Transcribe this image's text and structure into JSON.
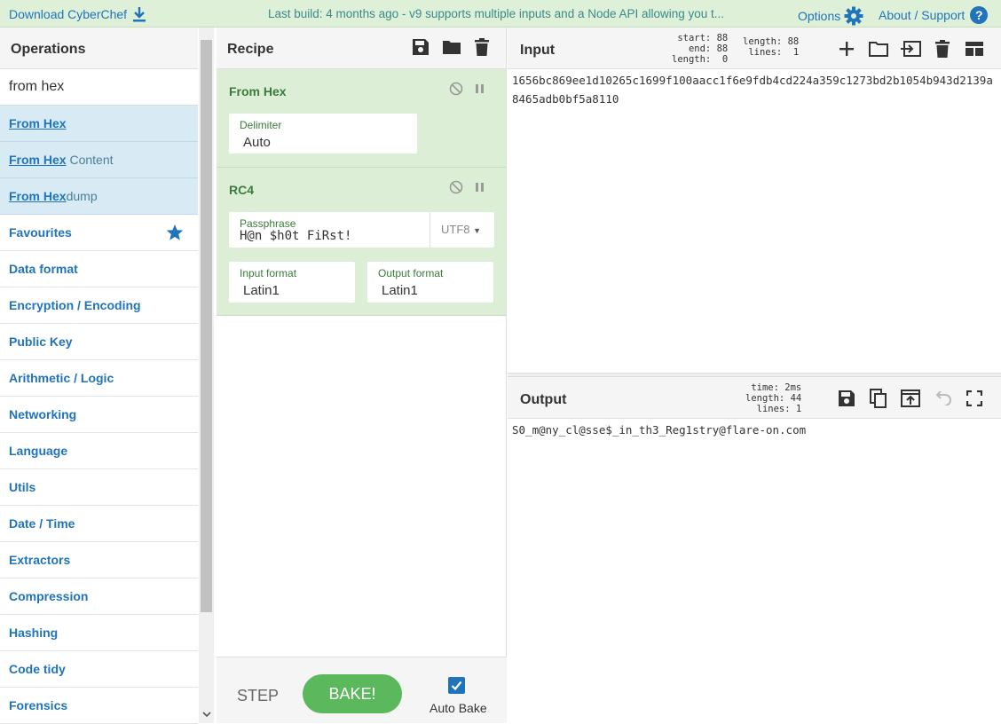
{
  "banner": {
    "download_label": "Download CyberChef",
    "message": "Last build: 4 months ago - v9 supports multiple inputs and a Node API allowing you t...",
    "options_label": "Options",
    "about_label": "About / Support",
    "help_glyph": "?"
  },
  "operations": {
    "title": "Operations",
    "search_value": "from hex",
    "results": [
      {
        "match": "From Hex",
        "rest": ""
      },
      {
        "match": "From Hex",
        "rest": " Content"
      },
      {
        "match": "From Hex",
        "rest": "dump"
      }
    ],
    "categories": [
      "Favourites",
      "Data format",
      "Encryption / Encoding",
      "Public Key",
      "Arithmetic / Logic",
      "Networking",
      "Language",
      "Utils",
      "Date / Time",
      "Extractors",
      "Compression",
      "Hashing",
      "Code tidy",
      "Forensics"
    ]
  },
  "recipe": {
    "title": "Recipe",
    "from_hex": {
      "title": "From Hex",
      "delimiter_label": "Delimiter",
      "delimiter_value": "Auto"
    },
    "rc4": {
      "title": "RC4",
      "passphrase_label": "Passphrase",
      "passphrase_value": "H@n $h0t FiRst!",
      "encoding": "UTF8",
      "input_format_label": "Input format",
      "input_format_value": "Latin1",
      "output_format_label": "Output format",
      "output_format_value": "Latin1"
    },
    "step_label": "STEP",
    "bake_label": "BAKE!",
    "autobake_label": "Auto Bake",
    "autobake_checked": true
  },
  "input": {
    "title": "Input",
    "stats_left": {
      "start": "88",
      "end": "88",
      "length": "0"
    },
    "stats_right": {
      "length": "88",
      "lines": "1"
    },
    "text": "1656bc869ee1d10265c1699f100aacc1f6e9fdb4cd224a359c1273bd2b1054b943d2139a8465adb0bf5a8110"
  },
  "output": {
    "title": "Output",
    "stats": {
      "time": "2ms",
      "length": "44",
      "lines": "1"
    },
    "text": "S0_m@ny_cl@sse$_in_th3_Reg1stry@flare-on.com"
  },
  "colors": {
    "accent": "#1f74bb",
    "banner_bg": "#dff0d8",
    "ingredient_bg": "#dcefd6",
    "bake_green": "#5cb85c",
    "search_highlight": "#d8ebf5"
  }
}
